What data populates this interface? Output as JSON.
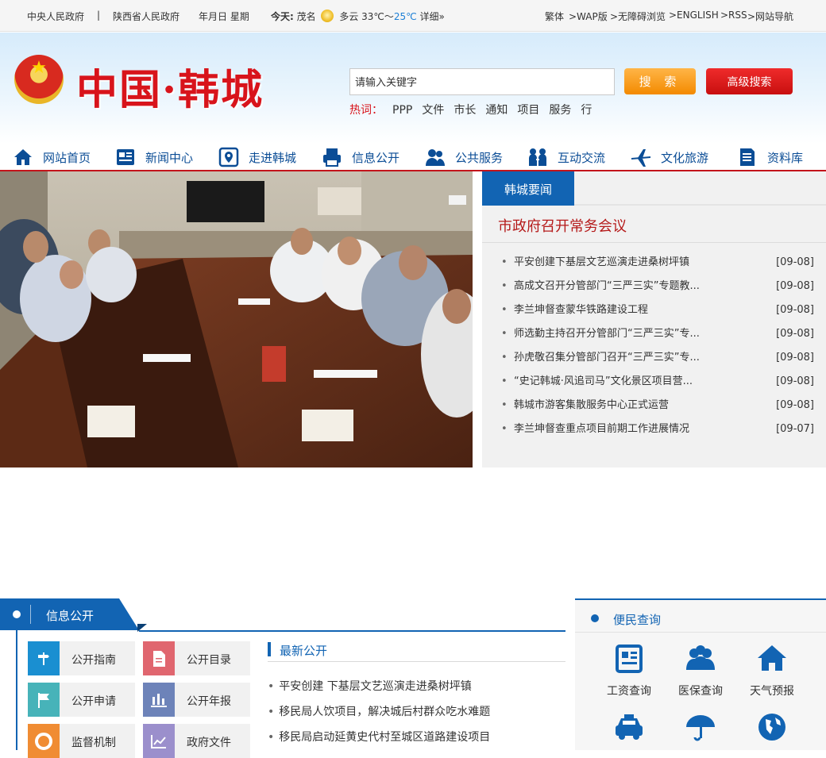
{
  "topbar": {
    "links_left": [
      "中央人民政府",
      "|",
      "陕西省人民政府"
    ],
    "date_text": "年月日 星期",
    "weather": {
      "today_label": "今天:",
      "city": "茂名",
      "condition": "多云",
      "temp_high": "33℃",
      "sep": "～",
      "temp_low": "25℃",
      "detail": "详细»"
    },
    "links_right": [
      "繁体",
      ">WAP版",
      ">无障碍浏览",
      ">ENGLISH",
      ">RSS",
      ">网站导航"
    ]
  },
  "header": {
    "site_title": "中国·韩城",
    "search": {
      "placeholder": "请输入关键字",
      "button": "搜 索",
      "advanced": "高级搜索"
    },
    "hot_label": "热词：",
    "hot_words": [
      "PPP",
      "文件",
      "市长",
      "通知",
      "项目",
      "服务",
      "行"
    ]
  },
  "nav": [
    "网站首页",
    "新闻中心",
    "走进韩城",
    "信息公开",
    "公共服务",
    "互动交流",
    "文化旅游",
    "资料库"
  ],
  "news": {
    "tab": "韩城要闻",
    "headline": "市政府召开常务会议",
    "items": [
      {
        "title": "平安创建下基层文艺巡演走进桑树坪镇",
        "date": "[09-08]"
      },
      {
        "title": "高成文召开分管部门“三严三实”专题教...",
        "date": "[09-08]"
      },
      {
        "title": "李兰坤督查蒙华铁路建设工程",
        "date": "[09-08]"
      },
      {
        "title": "师选勤主持召开分管部门“三严三实”专...",
        "date": "[09-08]"
      },
      {
        "title": "孙虎敬召集分管部门召开“三严三实”专...",
        "date": "[09-08]"
      },
      {
        "title": "“史记韩城·风追司马”文化景区项目营...",
        "date": "[09-08]"
      },
      {
        "title": "韩城市游客集散服务中心正式运营",
        "date": "[09-08]"
      },
      {
        "title": "李兰坤督查重点项目前期工作进展情况",
        "date": "[09-07]"
      }
    ]
  },
  "info": {
    "title": "信息公开",
    "tiles": [
      "公开指南",
      "公开目录",
      "公开申请",
      "公开年报",
      "监督机制",
      "政府文件"
    ],
    "tile_colors": [
      "#1a8fd1",
      "#e0666f",
      "#47b3b9",
      "#6d83b9",
      "#f08c33",
      "#9b8fcc"
    ],
    "latest_title": "最新公开",
    "latest": [
      "平安创建 下基层文艺巡演走进桑树坪镇",
      "移民局人饮项目，解决城后村群众吃水难题",
      "移民局启动延黄史代村至城区道路建设项目"
    ]
  },
  "services": {
    "title": "便民查询",
    "items": [
      "工资查询",
      "医保查询",
      "天气预报",
      "",
      "",
      ""
    ],
    "icons": [
      "salary-icon",
      "medical-insurance-icon",
      "weather-house-icon",
      "taxi-icon",
      "umbrella-icon",
      "globe-icon"
    ]
  }
}
